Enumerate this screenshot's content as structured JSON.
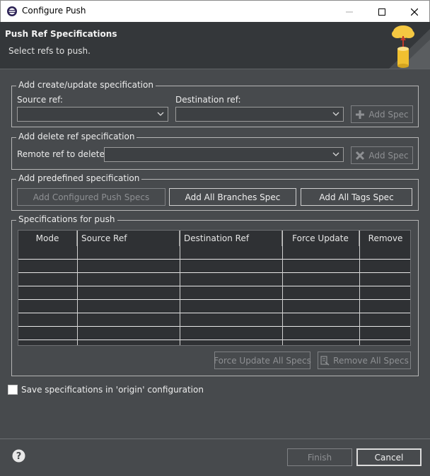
{
  "window": {
    "title": "Configure Push"
  },
  "header": {
    "title": "Push Ref Specifications",
    "subtitle": "Select refs to push."
  },
  "create_update": {
    "group_label": "Add create/update specification",
    "source_label": "Source ref:",
    "destination_label": "Destination ref:",
    "add_spec_label": "Add Spec"
  },
  "delete_ref": {
    "group_label": "Add delete ref specification",
    "remote_label": "Remote ref to delete:",
    "add_spec_label": "Add Spec"
  },
  "predefined": {
    "group_label": "Add predefined specification",
    "configured_label": "Add Configured Push Specs",
    "all_branches_label": "Add All Branches Spec",
    "all_tags_label": "Add All Tags Spec"
  },
  "specs": {
    "group_label": "Specifications for push",
    "columns": [
      "Mode",
      "Source Ref",
      "Destination Ref",
      "Force Update",
      "Remove"
    ],
    "rows": [],
    "force_all_label": "Force Update All Specs",
    "remove_all_label": "Remove All Specs"
  },
  "save_checkbox": {
    "label": "Save specifications in 'origin' configuration",
    "checked": false
  },
  "footer": {
    "finish_label": "Finish",
    "cancel_label": "Cancel"
  }
}
